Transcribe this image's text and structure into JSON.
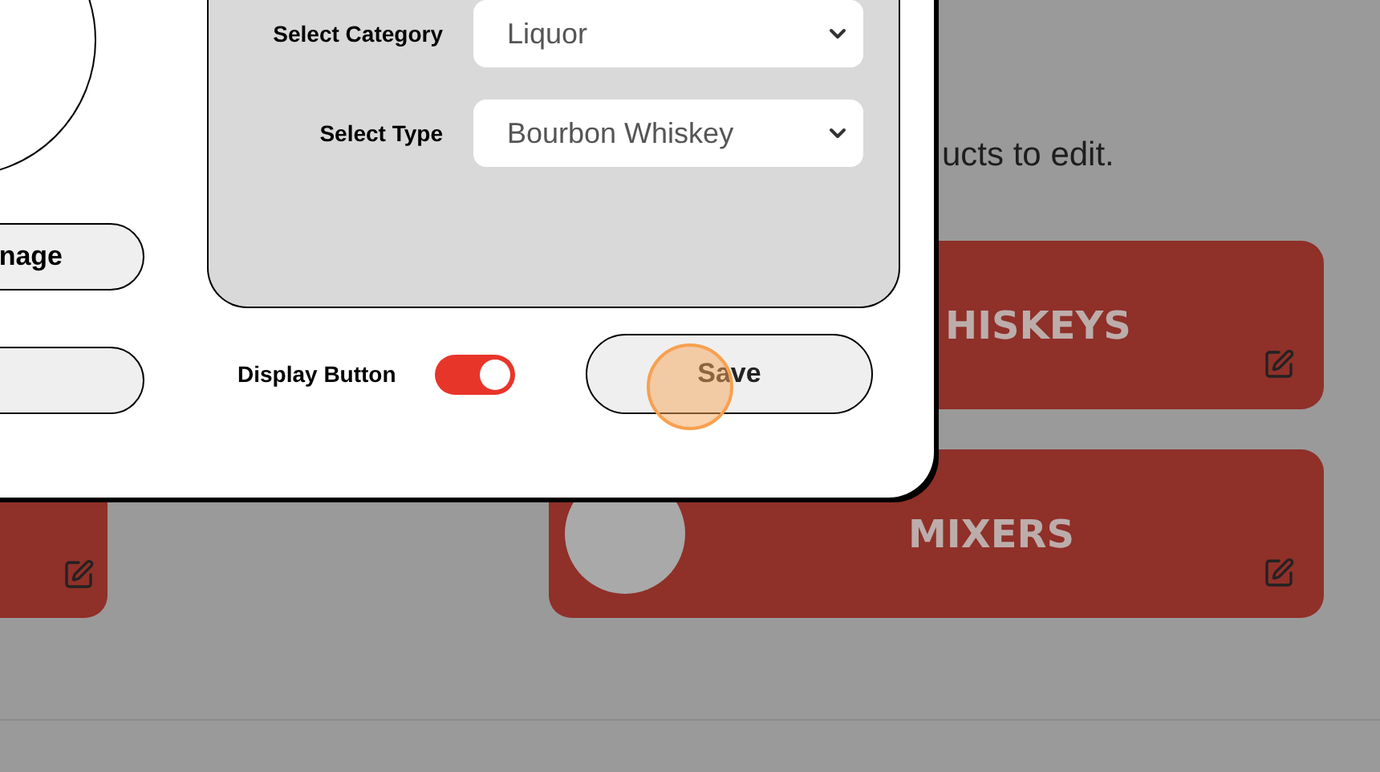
{
  "modal": {
    "image_button": "nage",
    "fields": [
      {
        "label": "Select Category",
        "value": "Liquor"
      },
      {
        "label": "Select Type",
        "value": "Bourbon Whiskey"
      }
    ],
    "display_button": {
      "label": "Display Button",
      "on": true
    },
    "save_button": "Save"
  },
  "page": {
    "instruction": "ucts to edit.",
    "categories": [
      {
        "title": "HISKEYS"
      },
      {
        "title": "MIXERS",
        "image": true
      }
    ]
  }
}
